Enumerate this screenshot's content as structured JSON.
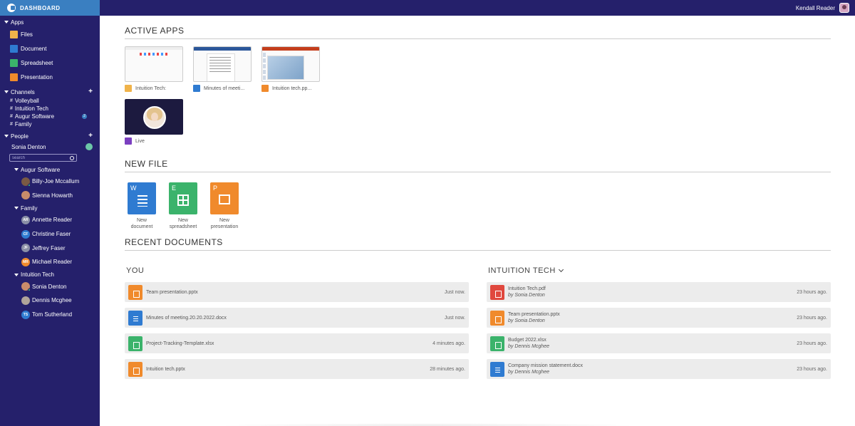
{
  "sidebar": {
    "brand": "DASHBOARD",
    "apps_label": "Apps",
    "apps": [
      {
        "label": "Files",
        "icon": "folder-icon"
      },
      {
        "label": "Document",
        "icon": "document-icon"
      },
      {
        "label": "Spreadsheet",
        "icon": "spreadsheet-icon"
      },
      {
        "label": "Presentation",
        "icon": "presentation-icon"
      }
    ],
    "channels_label": "Channels",
    "channels": [
      {
        "label": "Volleyball"
      },
      {
        "label": "Intuition Tech"
      },
      {
        "label": "Augur Software",
        "badge": "2"
      },
      {
        "label": "Family"
      }
    ],
    "people_label": "People",
    "me": "Sonia Denton",
    "search_placeholder": "search",
    "groups": [
      {
        "label": "Augur Software",
        "people": [
          {
            "name": "Billy-Joe Mccallum",
            "initials": "",
            "color": "#7a5a44"
          },
          {
            "name": "Sienna Howarth",
            "initials": "",
            "color": "#c98c6a"
          }
        ]
      },
      {
        "label": "Family",
        "people": [
          {
            "name": "Annette Reader",
            "initials": "AR",
            "color": "#8a8fa6"
          },
          {
            "name": "Christine Faser",
            "initials": "CF",
            "color": "#2f7bd1"
          },
          {
            "name": "Jeffrey Faser",
            "initials": "JF",
            "color": "#8a8fa6"
          },
          {
            "name": "Michael Reader",
            "initials": "MR",
            "color": "#f08a2c"
          }
        ]
      },
      {
        "label": "Intuition Tech",
        "people": [
          {
            "name": "Sonia Denton",
            "initials": "",
            "color": "#c98c6a"
          },
          {
            "name": "Dennis Mcghee",
            "initials": "",
            "color": "#b0a49a"
          },
          {
            "name": "Tom Sutherland",
            "initials": "TS",
            "color": "#2f7bd1"
          }
        ]
      }
    ]
  },
  "topbar": {
    "user": "Kendall Reader"
  },
  "main": {
    "active_apps_title": "ACTIVE APPS",
    "active_apps": [
      {
        "label": "Intuition Tech:"
      },
      {
        "label": "Minutes of meeti..."
      },
      {
        "label": "Intuition tech.pp..."
      },
      {
        "label": "Live"
      }
    ],
    "new_file_title": "NEW FILE",
    "new_files": [
      {
        "letter": "W",
        "line1": "New",
        "line2": "document"
      },
      {
        "letter": "E",
        "line1": "New",
        "line2": "spreadsheet"
      },
      {
        "letter": "P",
        "line1": "New",
        "line2": "presentation"
      }
    ],
    "recent_title": "RECENT DOCUMENTS",
    "you_title": "YOU",
    "you_docs": [
      {
        "name": "Team presentation.pptx",
        "time": "Just now."
      },
      {
        "name": "Minutes of meeting.20.20.2022.docx",
        "time": "Just now."
      },
      {
        "name": "Project-Tracking-Template.xlsx",
        "time": "4 minutes ago."
      },
      {
        "name": "Intuition tech.pptx",
        "time": "28 minutes ago."
      }
    ],
    "team_title": "INTUITION TECH",
    "team_docs": [
      {
        "name": "Intuition Tech.pdf",
        "by": "by Sonia Denton",
        "time": "23 hours ago."
      },
      {
        "name": "Team presentation.pptx",
        "by": "by Sonia Denton",
        "time": "23 hours ago."
      },
      {
        "name": "Budget 2022.xlsx",
        "by": "by Dennis Mcghee",
        "time": "23 hours ago."
      },
      {
        "name": "Company mission statement.docx",
        "by": "by Dennis Mcghee",
        "time": "23 hours ago."
      }
    ]
  },
  "colors": {
    "sidebar": "#25206b",
    "brand_bar": "#3a7fc1",
    "doc": "#2f7bd1",
    "sheet": "#3bb36b",
    "pres": "#f08a2c",
    "pdf": "#e0483e"
  }
}
